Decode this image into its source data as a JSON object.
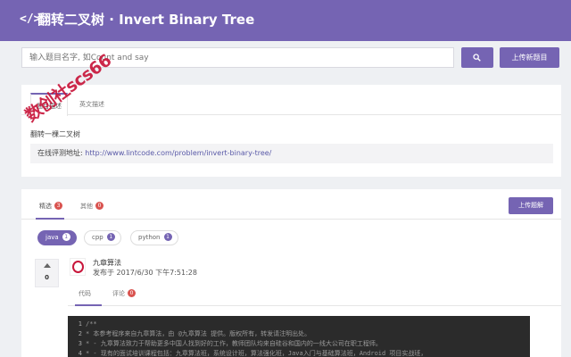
{
  "header": {
    "code_icon": "</>",
    "title": "翻转二叉树 · Invert Binary Tree"
  },
  "search": {
    "placeholder": "输入题目名字, 如Count and say",
    "upload_label": "上传新题目"
  },
  "watermark": "数创社scs66",
  "problem": {
    "tabs": [
      "题目描述",
      "英文描述"
    ],
    "description": "翻转一棵二叉树",
    "link_label": "在线评测地址: ",
    "link": "http://www.lintcode.com/problem/invert-binary-tree/"
  },
  "answers": {
    "tabs": [
      {
        "label": "精选",
        "count": "3"
      },
      {
        "label": "其他",
        "count": "0"
      }
    ],
    "upload_label": "上传题解",
    "languages": [
      {
        "name": "java",
        "count": "1",
        "active": true
      },
      {
        "name": "cpp",
        "count": "1",
        "active": false
      },
      {
        "name": "python",
        "count": "1",
        "active": false
      }
    ],
    "vote_count": "0",
    "author": "九章算法",
    "posted": "发布于 2017/6/30 下午7:51:28",
    "sub_tabs": [
      {
        "label": "代码"
      },
      {
        "label": "评论",
        "count": "0"
      }
    ],
    "code_lines": [
      {
        "n": "1",
        "text": "/**"
      },
      {
        "n": "2",
        "text": "* 本参考程序来自九章算法，由 @九章算法 提供。版权所有，转发请注明出处。"
      },
      {
        "n": "3",
        "text": "* - 九章算法致力于帮助更多中国人找到好的工作，教师团队均来自硅谷和国内的一线大公司在职工程师。"
      },
      {
        "n": "4",
        "text": "* - 现有的面试培训课程包括：九章算法班，系统设计班，算法强化班，Java入门与基础算法班，Android 项目实战班，"
      }
    ]
  }
}
